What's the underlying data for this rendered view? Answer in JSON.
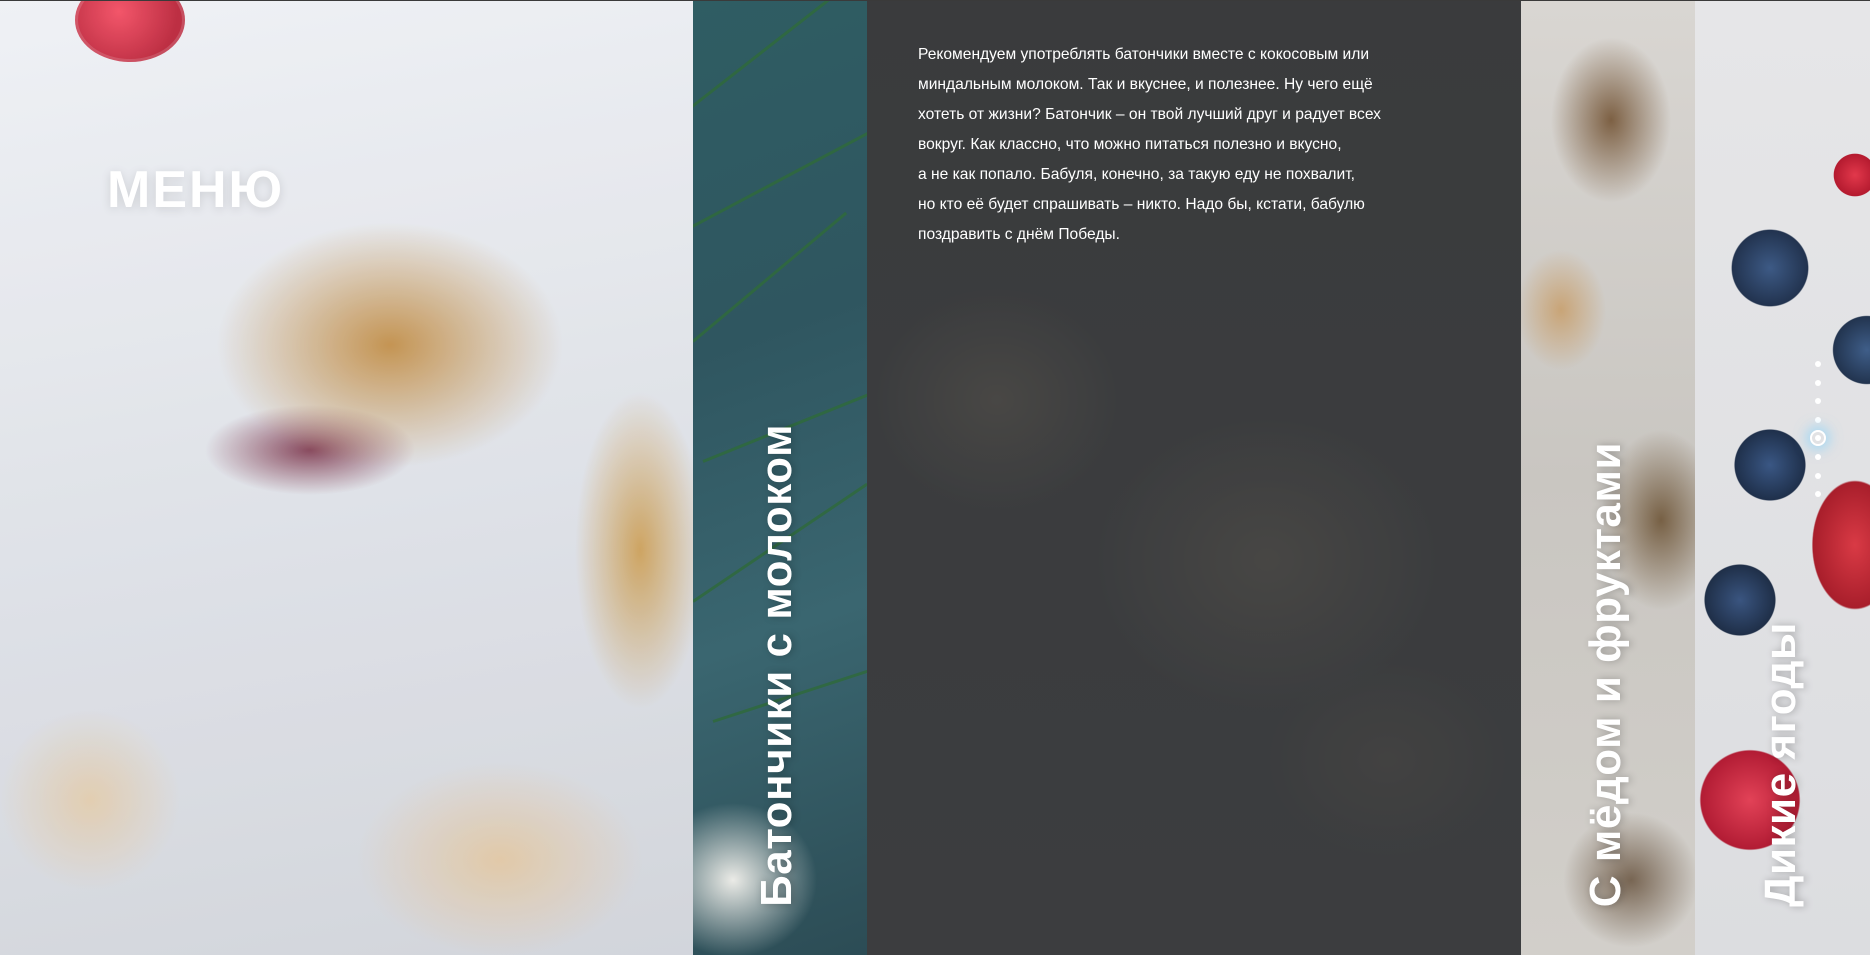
{
  "menu": {
    "title": "МЕНЮ"
  },
  "panels": [
    {
      "title": "Батончики с молоком"
    },
    {
      "title": "С мёдом и фруктами"
    },
    {
      "title": "Дикие ягоды"
    }
  ],
  "description": {
    "lines": [
      "Рекомендуем употреблять батончики вместе с кокосовым или",
      "миндальным молоком. Так и вкуснее, и полезнее. Ну чего ещё",
      "хотеть от жизни? Батончик – он твой лучший друг и радует всех",
      "вокруг. Как классно, что можно питаться полезно и вкусно,",
      "а не как попало. Бабуля, конечно, за такую еду не похвалит,",
      "но кто её будет спрашивать – никто. Надо бы, кстати, бабулю",
      "поздравить с днём Победы."
    ]
  },
  "pager": {
    "total": 8,
    "active": 4
  }
}
